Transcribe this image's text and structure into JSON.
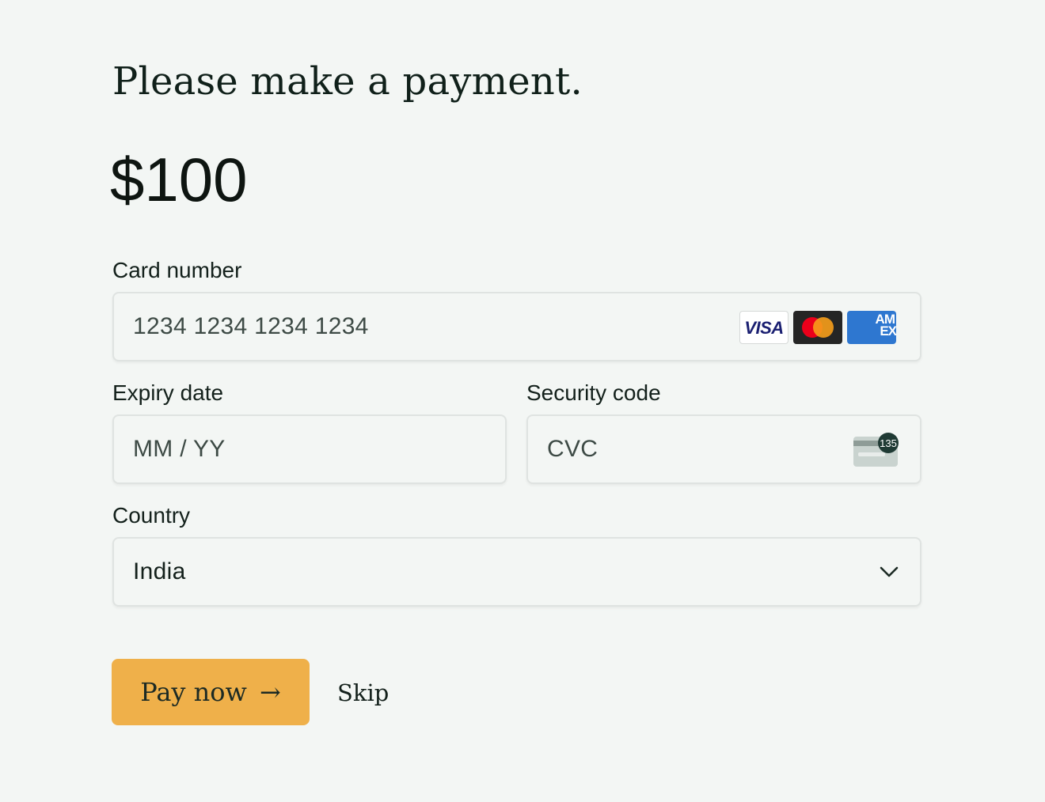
{
  "header": {
    "title": "Please make a payment.",
    "amount": "$100"
  },
  "form": {
    "card_number": {
      "label": "Card number",
      "placeholder": "1234 1234 1234 1234",
      "brands": [
        {
          "name": "visa-icon",
          "text": "VISA",
          "color": "#1a1f71"
        },
        {
          "name": "mastercard-icon",
          "colors": [
            "#eb001b",
            "#f79e1b"
          ]
        },
        {
          "name": "amex-icon",
          "text": "AM EX",
          "color": "#2e77d0"
        }
      ]
    },
    "expiry": {
      "label": "Expiry date",
      "placeholder": "MM / YY"
    },
    "security_code": {
      "label": "Security code",
      "placeholder": "CVC",
      "icon_text": "135"
    },
    "country": {
      "label": "Country",
      "value": "India"
    }
  },
  "actions": {
    "pay_label": "Pay now",
    "pay_arrow": "→",
    "skip_label": "Skip"
  },
  "colors": {
    "background": "#f3f6f4",
    "accent": "#efb04a",
    "text": "#13201b",
    "field_border": "#dfe3e1"
  }
}
